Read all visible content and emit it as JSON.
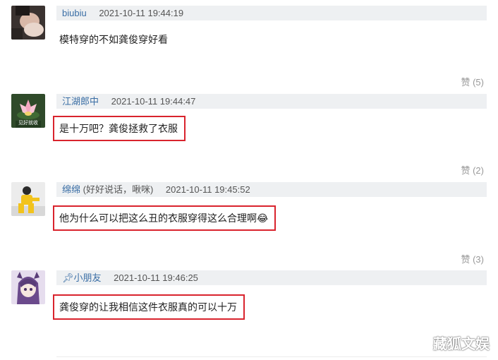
{
  "comments": [
    {
      "username": "biubiu",
      "note": "",
      "time": "2021-10-11 19:44:19",
      "text": "模特穿的不如龚俊穿好看",
      "likes": "赞 (5)"
    },
    {
      "username": "江湖郎中",
      "note": "",
      "time": "2021-10-11 19:44:47",
      "text": "是十万吧？龚俊拯救了衣服",
      "likes": "赞 (2)",
      "avatar_text": "见好就收"
    },
    {
      "username": "绵绵",
      "note": " (好好说话，啾咪)",
      "time": "2021-10-11 19:45:52",
      "text": "他为什么可以把这么丑的衣服穿得这么合理啊😂",
      "likes": "赞 (3)"
    },
    {
      "username": "小朋友",
      "note": "",
      "time": "2021-10-11 19:46:25",
      "text": "龚俊穿的让我相信这件衣服真的可以十万",
      "likes": ""
    }
  ],
  "watermark": "藏狐文娱",
  "colors": {
    "highlight_border": "#d9232d",
    "meta_bg": "#eef0f2",
    "username": "#3a6ea5"
  }
}
